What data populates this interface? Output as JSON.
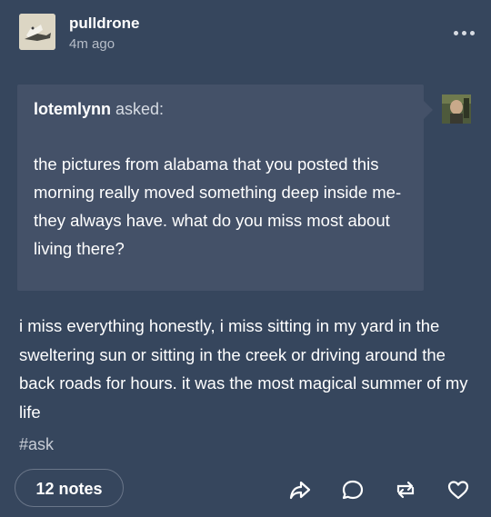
{
  "post": {
    "username": "pulldrone",
    "timestamp": "4m ago",
    "ask": {
      "asker": "lotemlynn",
      "asked_label": " asked:",
      "question": "the pictures from alabama that you posted this morning really moved something deep inside me-they always have. what do you miss most about living there?"
    },
    "answer": "i miss everything honestly, i miss sitting in my yard in the sweltering sun or sitting in the creek or driving around the back roads for hours. it was the most magical summer of my life",
    "tag": "#ask",
    "notes": "12 notes"
  },
  "icons": {
    "more": "more-horizontal-icon",
    "share": "share-icon",
    "reply": "reply-icon",
    "reblog": "reblog-icon",
    "like": "heart-icon"
  },
  "colors": {
    "background": "#36465d",
    "ask_background": "#445168",
    "text": "#ffffff",
    "muted": "#b6bdc8"
  }
}
